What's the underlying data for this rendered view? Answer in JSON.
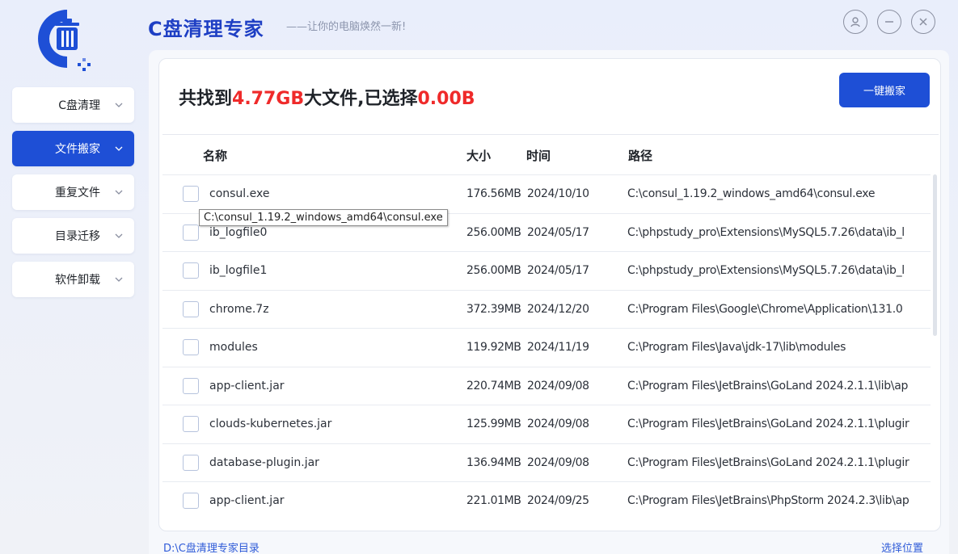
{
  "app": {
    "title": "C盘清理专家",
    "subtitle": "——让你的电脑焕然一新!",
    "logo_icon": "trash-bin-icon"
  },
  "window_controls": [
    {
      "name": "user-icon"
    },
    {
      "name": "minimize-icon"
    },
    {
      "name": "close-icon"
    }
  ],
  "sidebar": {
    "items": [
      {
        "label": "C盘清理",
        "active": false
      },
      {
        "label": "文件搬家",
        "active": true
      },
      {
        "label": "重复文件",
        "active": false
      },
      {
        "label": "目录迁移",
        "active": false
      },
      {
        "label": "软件卸载",
        "active": false
      }
    ]
  },
  "summary": {
    "prefix": "共找到",
    "found_size": "4.77GB",
    "middle": "大文件,已选择",
    "selected_size": "0.00B"
  },
  "actions": {
    "move_all_label": "一键搬家"
  },
  "table": {
    "headers": {
      "name": "名称",
      "size": "大小",
      "time": "时间",
      "path": "路径"
    },
    "rows": [
      {
        "name": "consul.exe",
        "size": "176.56MB",
        "time": "2024/10/10",
        "path": "C:\\consul_1.19.2_windows_amd64\\consul.exe"
      },
      {
        "name": "ib_logfile0",
        "size": "256.00MB",
        "time": "2024/05/17",
        "path": "C:\\phpstudy_pro\\Extensions\\MySQL5.7.26\\data\\ib_l"
      },
      {
        "name": "ib_logfile1",
        "size": "256.00MB",
        "time": "2024/05/17",
        "path": "C:\\phpstudy_pro\\Extensions\\MySQL5.7.26\\data\\ib_l"
      },
      {
        "name": "chrome.7z",
        "size": "372.39MB",
        "time": "2024/12/20",
        "path": "C:\\Program Files\\Google\\Chrome\\Application\\131.0"
      },
      {
        "name": "modules",
        "size": "119.92MB",
        "time": "2024/11/19",
        "path": "C:\\Program Files\\Java\\jdk-17\\lib\\modules"
      },
      {
        "name": "app-client.jar",
        "size": "220.74MB",
        "time": "2024/09/08",
        "path": "C:\\Program Files\\JetBrains\\GoLand 2024.2.1.1\\lib\\ap"
      },
      {
        "name": "clouds-kubernetes.jar",
        "size": "125.99MB",
        "time": "2024/09/08",
        "path": "C:\\Program Files\\JetBrains\\GoLand 2024.2.1.1\\plugir"
      },
      {
        "name": "database-plugin.jar",
        "size": "136.94MB",
        "time": "2024/09/08",
        "path": "C:\\Program Files\\JetBrains\\GoLand 2024.2.1.1\\plugir"
      },
      {
        "name": "app-client.jar",
        "size": "221.01MB",
        "time": "2024/09/25",
        "path": "C:\\Program Files\\JetBrains\\PhpStorm 2024.2.3\\lib\\ap"
      }
    ]
  },
  "tooltip": {
    "text": "C:\\consul_1.19.2_windows_amd64\\consul.exe"
  },
  "footer": {
    "target_dir": "D:\\C盘清理专家目录",
    "choose_location": "选择位置"
  },
  "colors": {
    "accent": "#1e4fd6",
    "highlight": "#ef2a2a",
    "link": "#2f5bd8"
  }
}
